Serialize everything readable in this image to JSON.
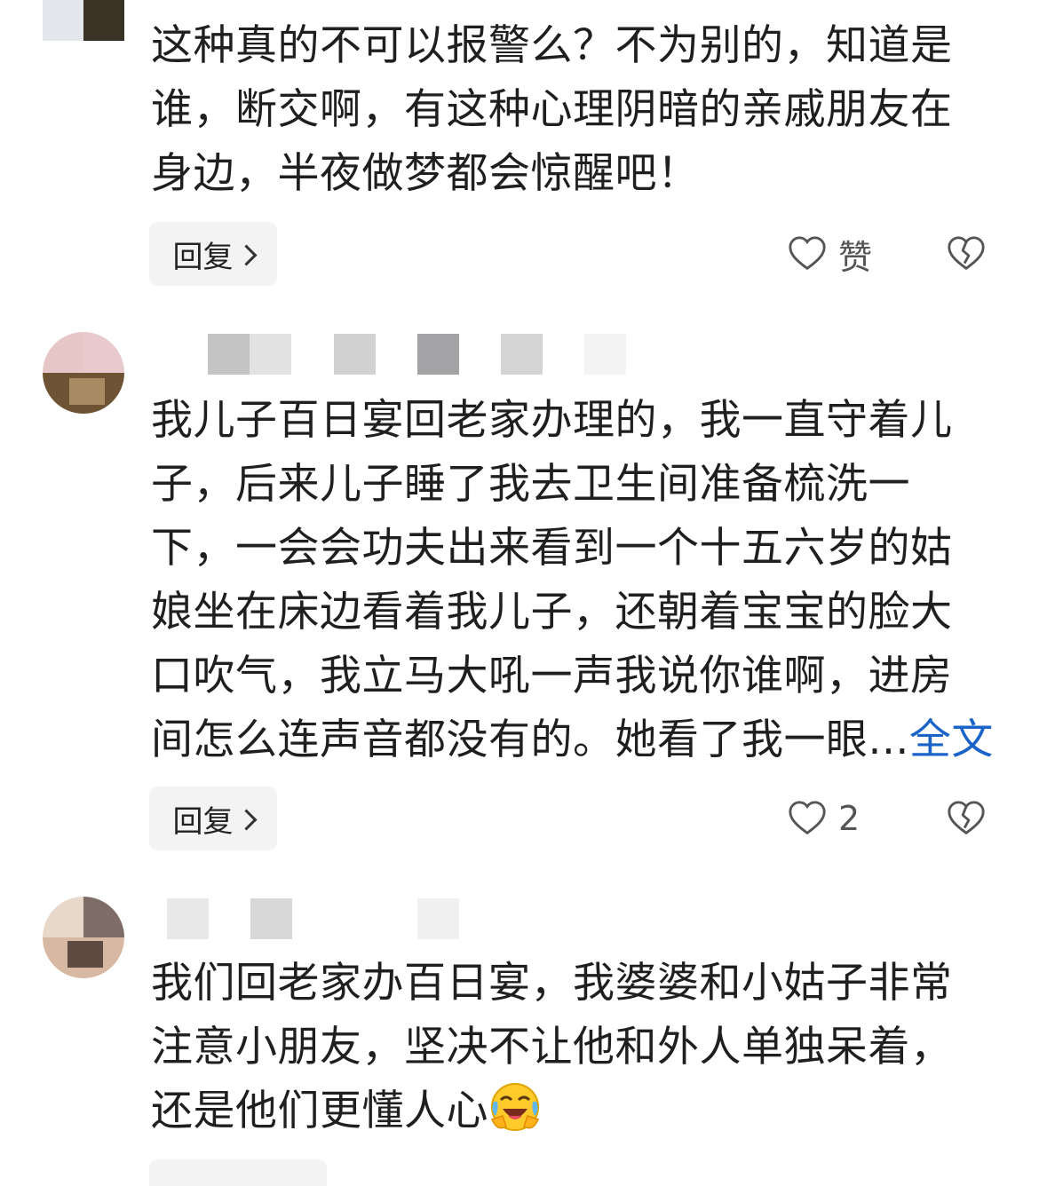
{
  "comments": [
    {
      "lines": [
        "这种真的不可以报警么？不为别的，知道是",
        "谁，断交啊，有这种心理阴暗的亲戚朋友在",
        "身边，半夜做梦都会惊醒吧！"
      ],
      "reply_label": "回复",
      "like_label": "赞",
      "dislike_icon": "broken-heart-icon",
      "like_icon": "heart-icon"
    },
    {
      "lines": [
        "我儿子百日宴回老家办理的，我一直守着儿",
        "子，后来儿子睡了我去卫生间准备梳洗一",
        "下，一会会功夫出来看到一个十五六岁的姑",
        "娘坐在床边看着我儿子，还朝着宝宝的脸大",
        "口吹气，我立马大吼一声我说你谁啊，进房",
        "间怎么连声音都没有的。她看了我一眼..."
      ],
      "more_label": "全文",
      "reply_label": "回复",
      "like_label": "2",
      "dislike_icon": "broken-heart-icon",
      "like_icon": "heart-icon"
    },
    {
      "lines": [
        "我们回老家办百日宴，我婆婆和小姑子非常",
        "注意小朋友，坚决不让他和外人单独呆着，",
        "还是他们更懂人心"
      ],
      "emoji": "laughing-crying-emoji"
    }
  ],
  "colors": {
    "link": "#1a63c9",
    "reply_bg": "#f3f3f3",
    "text": "#1f1f1f"
  }
}
